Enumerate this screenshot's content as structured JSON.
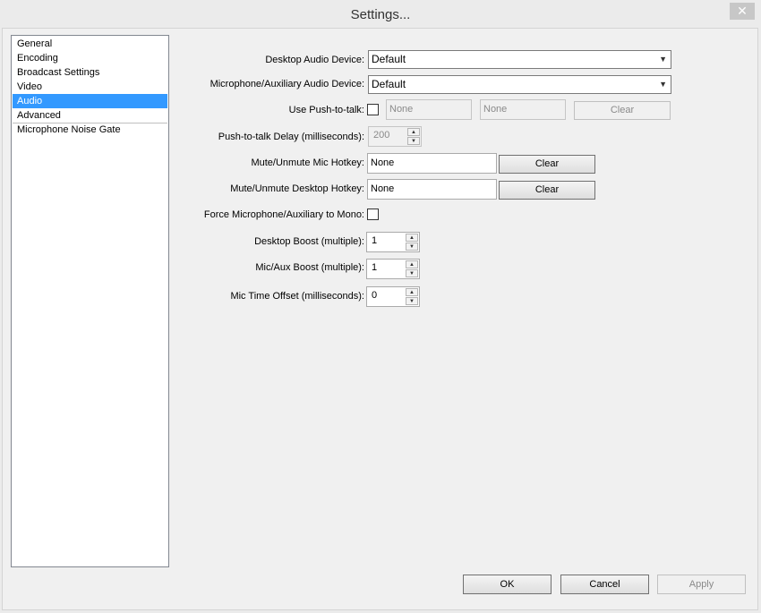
{
  "window": {
    "title": "Settings...",
    "close_glyph": "✕"
  },
  "nav": {
    "items": [
      {
        "label": "General"
      },
      {
        "label": "Encoding"
      },
      {
        "label": "Broadcast Settings"
      },
      {
        "label": "Video"
      },
      {
        "label": "Audio",
        "selected": true
      },
      {
        "label": "Advanced"
      },
      {
        "label": "Microphone Noise Gate"
      }
    ]
  },
  "audio": {
    "desktop_device": {
      "label": "Desktop Audio Device:",
      "value": "Default"
    },
    "mic_device": {
      "label": "Microphone/Auxiliary Audio Device:",
      "value": "Default"
    },
    "push_to_talk": {
      "label": "Use Push-to-talk:",
      "checked": false,
      "hotkey1": "None",
      "hotkey2": "None",
      "clear_label": "Clear"
    },
    "ptt_delay": {
      "label": "Push-to-talk Delay (milliseconds):",
      "value": "200"
    },
    "mute_mic": {
      "label": "Mute/Unmute Mic Hotkey:",
      "value": "None",
      "clear_label": "Clear"
    },
    "mute_desktop": {
      "label": "Mute/Unmute Desktop Hotkey:",
      "value": "None",
      "clear_label": "Clear"
    },
    "force_mono": {
      "label": "Force Microphone/Auxiliary to Mono:",
      "checked": false
    },
    "desktop_boost": {
      "label": "Desktop Boost (multiple):",
      "value": "1"
    },
    "mic_boost": {
      "label": "Mic/Aux Boost (multiple):",
      "value": "1"
    },
    "mic_offset": {
      "label": "Mic Time Offset (milliseconds):",
      "value": "0"
    }
  },
  "footer": {
    "ok_label": "OK",
    "cancel_label": "Cancel",
    "apply_label": "Apply"
  },
  "icons": {
    "dropdown": "chevron-down-icon",
    "spin_up": "arrow-up-icon",
    "spin_down": "arrow-down-icon",
    "close": "close-icon"
  }
}
